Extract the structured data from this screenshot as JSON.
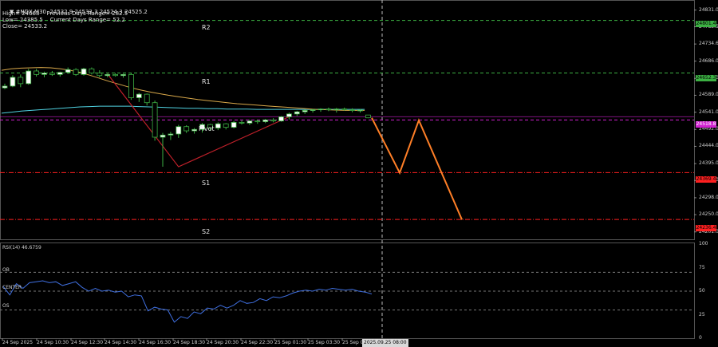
{
  "window": {
    "symbol_line": "#NDX,M30  24532.9 24533.3 24524.3 24525.2",
    "info_line1": "High= 24668    Previous Days Range= 282.5",
    "info_line2": "Low= 24385.5    Current Days Range= 52.2",
    "info_line3": "Close= 24533.2"
  },
  "levels": {
    "r2": "R2",
    "r1": "R1",
    "pivot": "Pivot",
    "s1": "S1",
    "s2": "S2",
    "r2_price": "24801.4",
    "r1_price": "24652.3",
    "pivot_price": "24518.8",
    "s1_price": "24369.4",
    "s2_price": "24236.4"
  },
  "price_axis": [
    "24831.0",
    "24783.5",
    "24734.6",
    "24686.0",
    "24637.0",
    "24589.0",
    "24541.0",
    "24492.0",
    "24444.0",
    "24395.0",
    "24347.0",
    "24298.0",
    "24250.0",
    "24201.0"
  ],
  "time_axis": [
    "24 Sep 2025",
    "24 Sep 10:30",
    "24 Sep 12:30",
    "24 Sep 14:30",
    "24 Sep 16:30",
    "24 Sep 18:30",
    "24 Sep 20:30",
    "24 Sep 22:30",
    "25 Sep 01:30",
    "25 Sep 03:30",
    "25 Sep 0"
  ],
  "time_cursor": "2025.09.25 08:00",
  "rsi": {
    "title": "RSI(14) 46.6759",
    "ob": "OB",
    "center": "CENTER",
    "os": "OS",
    "axis": [
      "100",
      "75",
      "50",
      "25",
      "0"
    ]
  },
  "colors": {
    "background": "#000000",
    "r_level": "#3cb043",
    "s_level": "#ff2020",
    "pivot_level": "#d020d0",
    "ma_fast": "#d9a84a",
    "ma_slow": "#4fd1e0",
    "projection": "#ff7f27",
    "zigzag": "#c0202a",
    "rsi_line": "#3f6fe0",
    "candle": "#ffffff",
    "candle_border": "#3cb043"
  },
  "chart_data": {
    "type": "candlestick",
    "timeframe": "M30",
    "candles": [
      {
        "o": 24610,
        "h": 24622,
        "l": 24606,
        "c": 24615
      },
      {
        "o": 24615,
        "h": 24646,
        "l": 24612,
        "c": 24640
      },
      {
        "o": 24640,
        "h": 24648,
        "l": 24612,
        "c": 24622
      },
      {
        "o": 24622,
        "h": 24664,
        "l": 24619,
        "c": 24658
      },
      {
        "o": 24658,
        "h": 24664,
        "l": 24642,
        "c": 24648
      },
      {
        "o": 24648,
        "h": 24656,
        "l": 24640,
        "c": 24652
      },
      {
        "o": 24652,
        "h": 24658,
        "l": 24644,
        "c": 24648
      },
      {
        "o": 24648,
        "h": 24656,
        "l": 24642,
        "c": 24654
      },
      {
        "o": 24654,
        "h": 24668,
        "l": 24650,
        "c": 24662
      },
      {
        "o": 24662,
        "h": 24666,
        "l": 24644,
        "c": 24648
      },
      {
        "o": 24648,
        "h": 24667,
        "l": 24645,
        "c": 24664
      },
      {
        "o": 24664,
        "h": 24668,
        "l": 24648,
        "c": 24652
      },
      {
        "o": 24652,
        "h": 24660,
        "l": 24640,
        "c": 24645
      },
      {
        "o": 24645,
        "h": 24650,
        "l": 24640,
        "c": 24648
      },
      {
        "o": 24648,
        "h": 24652,
        "l": 24642,
        "c": 24645
      },
      {
        "o": 24645,
        "h": 24650,
        "l": 24639,
        "c": 24648
      },
      {
        "o": 24648,
        "h": 24652,
        "l": 24576,
        "c": 24582
      },
      {
        "o": 24582,
        "h": 24596,
        "l": 24570,
        "c": 24592
      },
      {
        "o": 24592,
        "h": 24594,
        "l": 24560,
        "c": 24568
      },
      {
        "o": 24568,
        "h": 24574,
        "l": 24460,
        "c": 24470
      },
      {
        "o": 24470,
        "h": 24482,
        "l": 24386,
        "c": 24476
      },
      {
        "o": 24476,
        "h": 24485,
        "l": 24462,
        "c": 24479
      },
      {
        "o": 24479,
        "h": 24505,
        "l": 24468,
        "c": 24500
      },
      {
        "o": 24500,
        "h": 24504,
        "l": 24482,
        "c": 24488
      },
      {
        "o": 24488,
        "h": 24496,
        "l": 24480,
        "c": 24492
      },
      {
        "o": 24492,
        "h": 24510,
        "l": 24483,
        "c": 24506
      },
      {
        "o": 24506,
        "h": 24508,
        "l": 24488,
        "c": 24496
      },
      {
        "o": 24496,
        "h": 24512,
        "l": 24490,
        "c": 24508
      },
      {
        "o": 24508,
        "h": 24510,
        "l": 24492,
        "c": 24498
      },
      {
        "o": 24498,
        "h": 24516,
        "l": 24495,
        "c": 24512
      },
      {
        "o": 24512,
        "h": 24518,
        "l": 24506,
        "c": 24510
      },
      {
        "o": 24510,
        "h": 24520,
        "l": 24505,
        "c": 24516
      },
      {
        "o": 24516,
        "h": 24520,
        "l": 24508,
        "c": 24514
      },
      {
        "o": 24514,
        "h": 24522,
        "l": 24510,
        "c": 24519
      },
      {
        "o": 24519,
        "h": 24524,
        "l": 24512,
        "c": 24516
      },
      {
        "o": 24516,
        "h": 24530,
        "l": 24514,
        "c": 24528
      },
      {
        "o": 24528,
        "h": 24540,
        "l": 24520,
        "c": 24536
      },
      {
        "o": 24536,
        "h": 24545,
        "l": 24530,
        "c": 24542
      },
      {
        "o": 24542,
        "h": 24548,
        "l": 24536,
        "c": 24546
      },
      {
        "o": 24546,
        "h": 24550,
        "l": 24540,
        "c": 24548
      },
      {
        "o": 24548,
        "h": 24552,
        "l": 24542,
        "c": 24550
      },
      {
        "o": 24550,
        "h": 24554,
        "l": 24544,
        "c": 24548
      },
      {
        "o": 24548,
        "h": 24553,
        "l": 24540,
        "c": 24550
      },
      {
        "o": 24550,
        "h": 24554,
        "l": 24545,
        "c": 24548
      },
      {
        "o": 24548,
        "h": 24552,
        "l": 24541,
        "c": 24546
      },
      {
        "o": 24546,
        "h": 24550,
        "l": 24540,
        "c": 24547
      },
      {
        "o": 24533,
        "h": 24533,
        "l": 24524,
        "c": 24525
      }
    ],
    "ma_fast": [
      24660,
      24664,
      24666,
      24667,
      24668,
      24667,
      24664,
      24660,
      24654,
      24646,
      24637,
      24628,
      24620,
      24612,
      24605,
      24599,
      24594,
      24589,
      24585,
      24581,
      24577,
      24574,
      24571,
      24568,
      24565,
      24563,
      24561,
      24559,
      24557,
      24555,
      24553,
      24551,
      24549,
      24548,
      24547,
      24546,
      24546,
      24546
    ],
    "ma_slow": [
      24538,
      24541,
      24544,
      24546,
      24548,
      24550,
      24552,
      24554,
      24556,
      24557,
      24558,
      24558,
      24558,
      24558,
      24557,
      24556,
      24555,
      24554,
      24553,
      24552,
      24552,
      24551,
      24551,
      24550,
      24550,
      24550,
      24549,
      24549,
      24549,
      24549,
      24549,
      24549,
      24549,
      24549,
      24549,
      24549,
      24549,
      24549
    ],
    "projection": [
      24525,
      24369,
      24518,
      24236
    ],
    "rsi": [
      55,
      46,
      58,
      53,
      59,
      60,
      61,
      59,
      60,
      56,
      58,
      60,
      54,
      50,
      53,
      50,
      51,
      49,
      50,
      44,
      46,
      45,
      29,
      33,
      31,
      30,
      17,
      23,
      21,
      28,
      26,
      32,
      31,
      35,
      32,
      35,
      40,
      37,
      38,
      42,
      40,
      44,
      43,
      45,
      48,
      50,
      51,
      50,
      52,
      51,
      53,
      52,
      51,
      52,
      50,
      49,
      47
    ]
  }
}
